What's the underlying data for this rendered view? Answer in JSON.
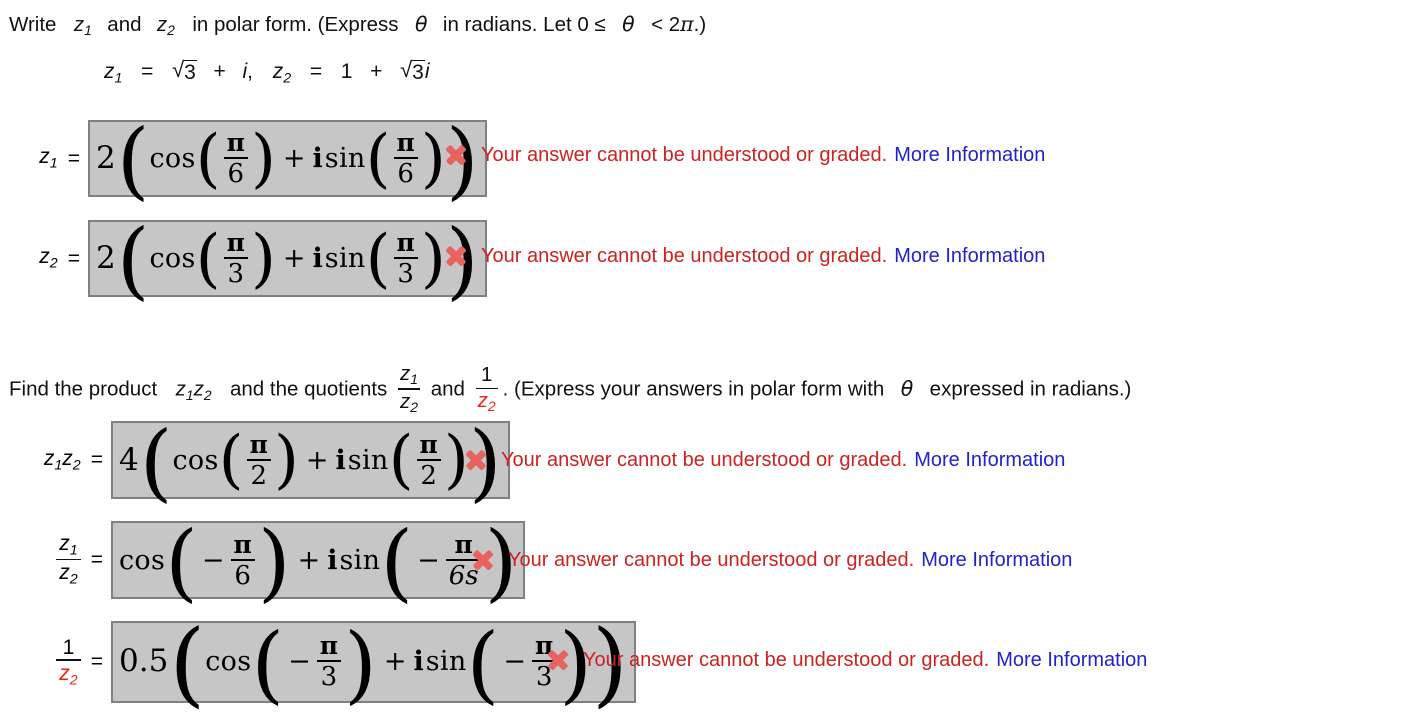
{
  "question1": {
    "text_before": "Write",
    "var1": "z",
    "var1_sub": "1",
    "and": "and",
    "var2": "z",
    "var2_sub": "2",
    "text_after": "in polar form. (Express",
    "theta": "θ",
    "text_after2": "in radians. Let 0 ≤",
    "theta2": "θ",
    "text_after3": "< 2",
    "pi": "π",
    "text_end": ".)"
  },
  "given": {
    "z1_label": "z",
    "z1_sub": "1",
    "eq1": "=",
    "radicand1": "3",
    "plus1": "+",
    "i1": "i",
    "comma": ",",
    "z2_label": "z",
    "z2_sub": "2",
    "eq2": "=",
    "one": "1",
    "plus2": "+",
    "radicand2": "3",
    "i2": "i"
  },
  "question2": {
    "part1": "Find the product",
    "prod_z": "z",
    "prod_sub1": "1",
    "prod_z2": "z",
    "prod_sub2": "2",
    "part2": "and the quotients",
    "frac1_num_z": "z",
    "frac1_num_sub": "1",
    "frac1_den_z": "z",
    "frac1_den_sub": "2",
    "and": "and",
    "frac2_num": "1",
    "frac2_den_z": "z",
    "frac2_den_sub": "2",
    "part3": ". (Express your answers in polar form with",
    "theta": "θ",
    "part4": "expressed in radians.)"
  },
  "feedback_message": "Your answer cannot be understood or graded.",
  "feedback_link": "More Information",
  "colors": {
    "error_red": "#cc2222",
    "link_blue": "#2222cc",
    "x_icon": "#e8625f",
    "box_bg": "#c6c6c6",
    "box_border": "#808080",
    "highlight_red": "#ee2211"
  },
  "answers": [
    {
      "id": "z1",
      "label_kind": "inline",
      "label_main": "z",
      "label_sub": "1",
      "equals": "=",
      "coefficient": "2",
      "cos_label": "cos",
      "plus": "+",
      "i_label": "i",
      "sin_label": "sin",
      "cos_negative": false,
      "sin_negative": false,
      "cos_num": "π",
      "cos_den": "6",
      "sin_num": "π",
      "sin_den": "6"
    },
    {
      "id": "z2",
      "label_kind": "inline",
      "label_main": "z",
      "label_sub": "2",
      "equals": "=",
      "coefficient": "2",
      "cos_label": "cos",
      "plus": "+",
      "i_label": "i",
      "sin_label": "sin",
      "cos_negative": false,
      "sin_negative": false,
      "cos_num": "π",
      "cos_den": "3",
      "sin_num": "π",
      "sin_den": "3"
    },
    {
      "id": "z1z2",
      "label_kind": "product",
      "label_main": "z",
      "label_sub": "1",
      "label_main2": "z",
      "label_sub2": "2",
      "equals": "=",
      "coefficient": "4",
      "cos_label": "cos",
      "plus": "+",
      "i_label": "i",
      "sin_label": "sin",
      "cos_negative": false,
      "sin_negative": false,
      "cos_num": "π",
      "cos_den": "2",
      "sin_num": "π",
      "sin_den": "2"
    },
    {
      "id": "z1-over-z2",
      "label_kind": "fraction",
      "frac_num": "z",
      "frac_num_sub": "1",
      "frac_den": "z",
      "frac_den_sub": "2",
      "frac_den_red": false,
      "equals": "=",
      "coefficient": "",
      "cos_label": "cos",
      "plus": "+",
      "i_label": "i",
      "sin_label": "sin",
      "cos_negative": true,
      "sin_negative": true,
      "cos_num": "π",
      "cos_den": "6",
      "sin_num": "π",
      "sin_den": "6s"
    },
    {
      "id": "one-over-z2",
      "label_kind": "fraction",
      "frac_num": "1",
      "frac_num_sub": "",
      "frac_den": "z",
      "frac_den_sub": "2",
      "frac_den_red": true,
      "equals": "=",
      "coefficient": "0.5",
      "cos_label": "cos",
      "plus": "+",
      "i_label": "i",
      "sin_label": "sin",
      "cos_negative": true,
      "sin_negative": true,
      "cos_num": "π",
      "cos_den": "3",
      "sin_num": "π",
      "sin_den": "3"
    }
  ]
}
